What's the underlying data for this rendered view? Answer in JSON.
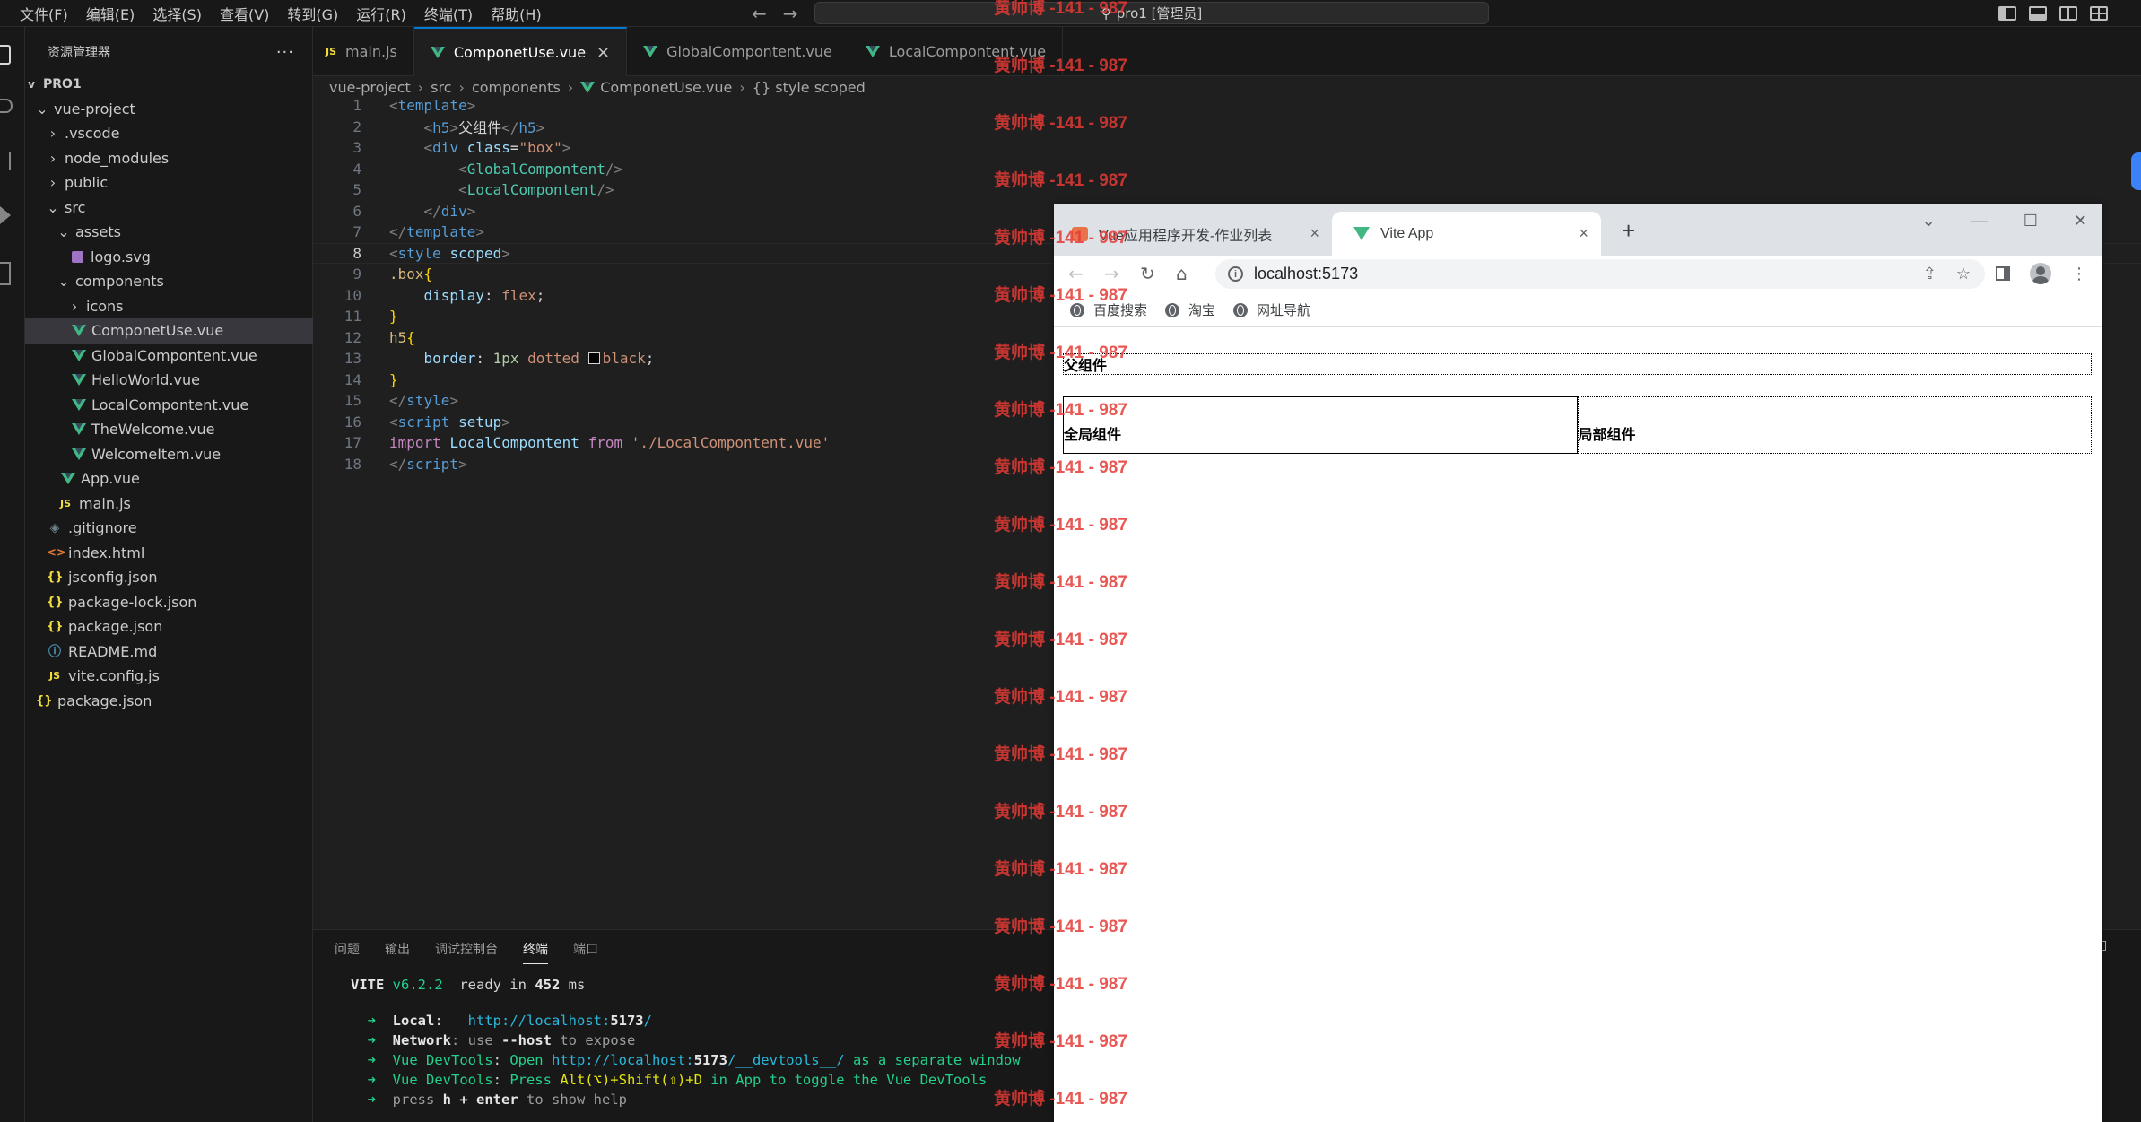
{
  "menu": [
    "文件(F)",
    "编辑(E)",
    "选择(S)",
    "查看(V)",
    "转到(G)",
    "运行(R)",
    "终端(T)",
    "帮助(H)"
  ],
  "command_center": "pro1 [管理员]",
  "explorer": {
    "title": "资源管理器",
    "more": "···",
    "root": "PRO1",
    "items": [
      {
        "label": "vue-project",
        "indent": 1,
        "chev": "v",
        "icon": "none"
      },
      {
        "label": ".vscode",
        "indent": 2,
        "chev": ">",
        "icon": "none"
      },
      {
        "label": "node_modules",
        "indent": 2,
        "chev": ">",
        "icon": "none"
      },
      {
        "label": "public",
        "indent": 2,
        "chev": ">",
        "icon": "none"
      },
      {
        "label": "src",
        "indent": 2,
        "chev": "v",
        "icon": "none"
      },
      {
        "label": "assets",
        "indent": 3,
        "chev": "v",
        "icon": "none"
      },
      {
        "label": "logo.svg",
        "indent": 4,
        "chev": "",
        "icon": "svg"
      },
      {
        "label": "components",
        "indent": 3,
        "chev": "v",
        "icon": "none"
      },
      {
        "label": "icons",
        "indent": 4,
        "chev": ">",
        "icon": "none"
      },
      {
        "label": "ComponetUse.vue",
        "indent": 4,
        "chev": "",
        "icon": "vue",
        "active": true
      },
      {
        "label": "GlobalCompontent.vue",
        "indent": 4,
        "chev": "",
        "icon": "vue"
      },
      {
        "label": "HelloWorld.vue",
        "indent": 4,
        "chev": "",
        "icon": "vue"
      },
      {
        "label": "LocalCompontent.vue",
        "indent": 4,
        "chev": "",
        "icon": "vue"
      },
      {
        "label": "TheWelcome.vue",
        "indent": 4,
        "chev": "",
        "icon": "vue"
      },
      {
        "label": "WelcomeItem.vue",
        "indent": 4,
        "chev": "",
        "icon": "vue"
      },
      {
        "label": "App.vue",
        "indent": 3,
        "chev": "",
        "icon": "vue"
      },
      {
        "label": "main.js",
        "indent": 3,
        "chev": "",
        "icon": "js"
      },
      {
        "label": ".gitignore",
        "indent": 2,
        "chev": "",
        "icon": "git"
      },
      {
        "label": "index.html",
        "indent": 2,
        "chev": "",
        "icon": "html"
      },
      {
        "label": "jsconfig.json",
        "indent": 2,
        "chev": "",
        "icon": "json"
      },
      {
        "label": "package-lock.json",
        "indent": 2,
        "chev": "",
        "icon": "json"
      },
      {
        "label": "package.json",
        "indent": 2,
        "chev": "",
        "icon": "json"
      },
      {
        "label": "README.md",
        "indent": 2,
        "chev": "",
        "icon": "info"
      },
      {
        "label": "vite.config.js",
        "indent": 2,
        "chev": "",
        "icon": "js"
      },
      {
        "label": "package.json",
        "indent": 1,
        "chev": "",
        "icon": "json"
      }
    ]
  },
  "editor_tabs": [
    {
      "label": "main.js",
      "icon": "js",
      "active": false
    },
    {
      "label": "ComponetUse.vue",
      "icon": "vue",
      "active": true,
      "close": "×"
    },
    {
      "label": "GlobalCompontent.vue",
      "icon": "vue",
      "active": false
    },
    {
      "label": "LocalCompontent.vue",
      "icon": "vue",
      "active": false
    }
  ],
  "breadcrumb": [
    "vue-project",
    "src",
    "components",
    "ComponetUse.vue",
    "{} style scoped"
  ],
  "code_lines": [
    [
      [
        "t-br",
        "<"
      ],
      [
        "t-tag",
        "template"
      ],
      [
        "t-br",
        ">"
      ]
    ],
    [
      [
        "t-txt",
        "    "
      ],
      [
        "t-br",
        "<"
      ],
      [
        "t-tag",
        "h5"
      ],
      [
        "t-br",
        ">"
      ],
      [
        "t-txt",
        "父组件"
      ],
      [
        "t-br",
        "</"
      ],
      [
        "t-tag",
        "h5"
      ],
      [
        "t-br",
        ">"
      ]
    ],
    [
      [
        "t-txt",
        "    "
      ],
      [
        "t-br",
        "<"
      ],
      [
        "t-tag",
        "div"
      ],
      [
        "t-txt",
        " "
      ],
      [
        "t-attr",
        "class"
      ],
      [
        "t-txt",
        "="
      ],
      [
        "t-str",
        "\"box\""
      ],
      [
        "t-br",
        ">"
      ]
    ],
    [
      [
        "t-txt",
        "        "
      ],
      [
        "t-br",
        "<"
      ],
      [
        "t-comp",
        "GlobalCompontent"
      ],
      [
        "t-br",
        "/>"
      ]
    ],
    [
      [
        "t-txt",
        "        "
      ],
      [
        "t-br",
        "<"
      ],
      [
        "t-comp",
        "LocalCompontent"
      ],
      [
        "t-br",
        "/>"
      ]
    ],
    [
      [
        "t-txt",
        "    "
      ],
      [
        "t-br",
        "</"
      ],
      [
        "t-tag",
        "div"
      ],
      [
        "t-br",
        ">"
      ]
    ],
    [
      [
        "t-br",
        "</"
      ],
      [
        "t-tag",
        "template"
      ],
      [
        "t-br",
        ">"
      ]
    ],
    [
      [
        "t-br",
        "<"
      ],
      [
        "t-tag",
        "style"
      ],
      [
        "t-txt",
        " "
      ],
      [
        "t-attr",
        "scoped"
      ],
      [
        "t-br",
        ">"
      ]
    ],
    [
      [
        "t-sel",
        ".box"
      ],
      [
        "t-brace",
        "{"
      ]
    ],
    [
      [
        "t-txt",
        "    "
      ],
      [
        "t-prop",
        "display"
      ],
      [
        "t-txt",
        ": "
      ],
      [
        "t-val",
        "flex"
      ],
      [
        "t-txt",
        ";"
      ]
    ],
    [
      [
        "t-brace",
        "}"
      ]
    ],
    [
      [
        "t-sel",
        "h5"
      ],
      [
        "t-brace",
        "{"
      ]
    ],
    [
      [
        "t-txt",
        "    "
      ],
      [
        "t-prop",
        "border"
      ],
      [
        "t-txt",
        ": "
      ],
      [
        "t-num",
        "1px"
      ],
      [
        "t-txt",
        " "
      ],
      [
        "t-val",
        "dotted"
      ],
      [
        "t-txt",
        " "
      ],
      [
        "colorbox",
        ""
      ],
      [
        "t-val",
        "black"
      ],
      [
        "t-txt",
        ";"
      ]
    ],
    [
      [
        "t-brace",
        "}"
      ]
    ],
    [
      [
        "t-br",
        "</"
      ],
      [
        "t-tag",
        "style"
      ],
      [
        "t-br",
        ">"
      ]
    ],
    [
      [
        "t-br",
        "<"
      ],
      [
        "t-tag",
        "script"
      ],
      [
        "t-txt",
        " "
      ],
      [
        "t-attr",
        "setup"
      ],
      [
        "t-br",
        ">"
      ]
    ],
    [
      [
        "t-kw",
        "import"
      ],
      [
        "t-txt",
        " "
      ],
      [
        "t-var",
        "LocalCompontent"
      ],
      [
        "t-txt",
        " "
      ],
      [
        "t-kw",
        "from"
      ],
      [
        "t-txt",
        " "
      ],
      [
        "t-str",
        "'./LocalCompontent.vue'"
      ]
    ],
    [
      [
        "t-br",
        "</"
      ],
      [
        "t-tag",
        "script"
      ],
      [
        "t-br",
        ">"
      ]
    ]
  ],
  "current_line": 8,
  "panel_tabs": [
    "问题",
    "输出",
    "调试控制台",
    "终端",
    "端口"
  ],
  "panel_active_tab": 3,
  "terminal_lines": [
    [
      [
        "t-green t-bold",
        "VITE"
      ],
      [
        "t-green",
        " v6.2.2"
      ],
      [
        "t-txt",
        "  ready in "
      ],
      [
        "t-bold",
        "452"
      ],
      [
        "t-txt",
        " ms"
      ]
    ],
    [],
    [
      [
        "t-green",
        "  ➜  "
      ],
      [
        "t-bold",
        "Local"
      ],
      [
        "t-txt",
        ":   "
      ],
      [
        "t-cyan",
        "http://localhost:"
      ],
      [
        "t-cyan t-bold",
        "5173"
      ],
      [
        "t-cyan",
        "/"
      ]
    ],
    [
      [
        "t-green",
        "  ➜  "
      ],
      [
        "t-bold",
        "Network"
      ],
      [
        "t-dim",
        ": use "
      ],
      [
        "t-bold",
        "--host"
      ],
      [
        "t-dim",
        " to expose"
      ]
    ],
    [
      [
        "t-green",
        "  ➜  Vue DevTools"
      ],
      [
        "t-txt",
        ": "
      ],
      [
        "t-green",
        "Open "
      ],
      [
        "t-cyan",
        "http://localhost:"
      ],
      [
        "t-cyan t-bold",
        "5173"
      ],
      [
        "t-cyan",
        "/__devtools__/"
      ],
      [
        "t-green",
        " as a separate window"
      ]
    ],
    [
      [
        "t-green",
        "  ➜  Vue DevTools"
      ],
      [
        "t-txt",
        ": "
      ],
      [
        "t-green",
        "Press "
      ],
      [
        "t-yellow",
        "Alt(⌥)+Shift(⇧)+D"
      ],
      [
        "t-green",
        " in App to toggle the Vue DevTools"
      ]
    ],
    [
      [
        "t-green",
        "  ➜  "
      ],
      [
        "t-dim",
        "press "
      ],
      [
        "t-bold",
        "h + enter"
      ],
      [
        "t-dim",
        " to show help"
      ]
    ]
  ],
  "browser": {
    "tabs": [
      {
        "label": "Vue应用程序开发-作业列表",
        "favicon": "orange",
        "close": "×"
      },
      {
        "label": "Vite App",
        "favicon": "vue",
        "close": "×"
      }
    ],
    "new_tab": "+",
    "window_controls": [
      "⌄",
      "—",
      "☐",
      "✕"
    ],
    "url": "localhost:5173",
    "bookmarks": [
      "百度搜索",
      "淘宝",
      "网址导航"
    ],
    "page": {
      "h5": "父组件",
      "global": "全局组件",
      "local": "局部组件"
    }
  },
  "watermark": "黄帅博 -141 - 987"
}
